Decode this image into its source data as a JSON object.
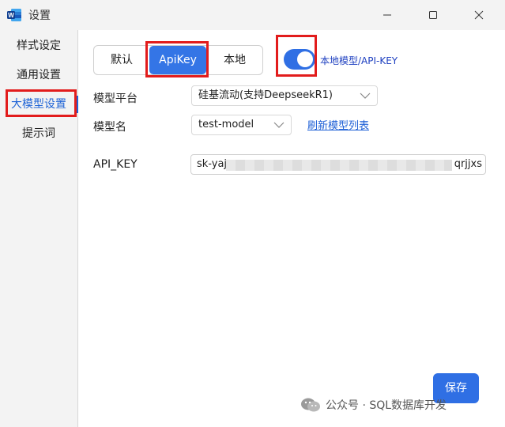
{
  "window": {
    "title": "设置"
  },
  "sidebar": {
    "items": [
      {
        "label": "样式设定"
      },
      {
        "label": "通用设置"
      },
      {
        "label": "大模型设置"
      },
      {
        "label": "提示词"
      }
    ]
  },
  "main": {
    "tabs": [
      {
        "label": "默认"
      },
      {
        "label": "ApiKey"
      },
      {
        "label": "本地"
      }
    ],
    "toggle_label": "本地模型/API-KEY",
    "platform_label": "模型平台",
    "platform_value": "硅基流动(支持DeepseekR1)",
    "model_label": "模型名",
    "model_value": "test-model",
    "refresh_link": "刷新模型列表",
    "apikey_label": "API_KEY",
    "apikey_prefix": "sk-yaj",
    "apikey_suffix": "qrjjxs",
    "save_label": "保存"
  },
  "watermark": {
    "text": "公众号 · SQL数据库开发"
  },
  "colors": {
    "accent": "#2f6fe4",
    "highlight": "#e21c1c"
  }
}
